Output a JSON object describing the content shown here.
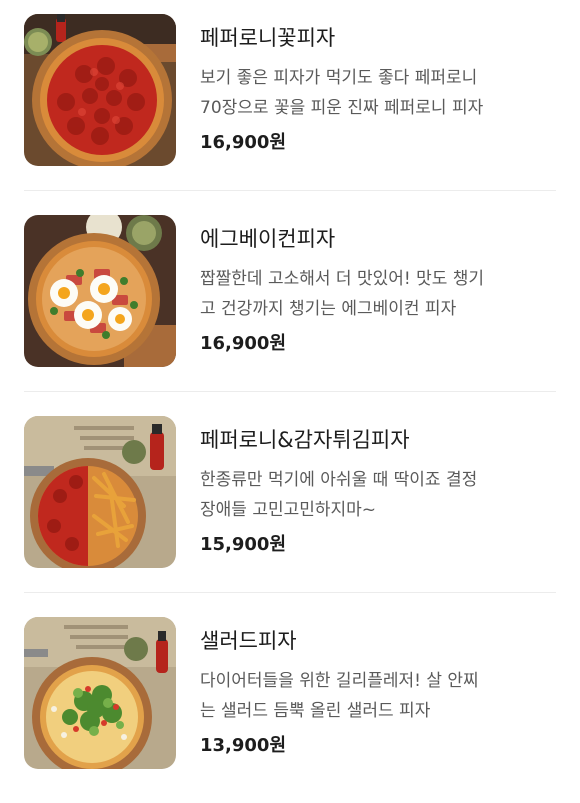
{
  "menu": {
    "items": [
      {
        "name": "페퍼로니꽃피자",
        "desc_line1": "보기 좋은 피자가 먹기도 좋다 페퍼로니",
        "desc_line2": "70장으로 꽃을 피운 진짜 페퍼로니 피자",
        "price": "16,900원",
        "image_icon": "pepperoni-pizza-photo"
      },
      {
        "name": "에그베이컨피자",
        "desc_line1": "짭짤한데 고소해서 더 맛있어! 맛도 챙기",
        "desc_line2": "고 건강까지 챙기는 에그베이컨 피자",
        "price": "16,900원",
        "image_icon": "egg-bacon-pizza-photo"
      },
      {
        "name": "페퍼로니&감자튀김피자",
        "desc_line1": "한종류만 먹기에 아쉬울 때 딱이죠 결정",
        "desc_line2": "장애들 고민고민하지마~",
        "price": "15,900원",
        "image_icon": "pepperoni-fries-pizza-photo"
      },
      {
        "name": "샐러드피자",
        "desc_line1": "다이어터들을 위한 길리플레저! 살 안찌",
        "desc_line2": "는 샐러드 듬뿍 올린 샐러드 피자",
        "price": "13,900원",
        "image_icon": "salad-pizza-photo"
      }
    ]
  },
  "colors": {
    "text_primary": "#1d1d1d",
    "text_secondary": "#5a5a5a",
    "divider": "#ececec",
    "crust": "#d98b3a",
    "pepperoni": "#c0281e",
    "board": "#a86b3a"
  }
}
